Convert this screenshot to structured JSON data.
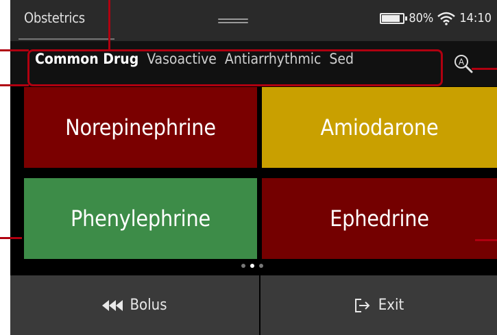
{
  "header": {
    "title": "Obstetrics",
    "battery_percent": "80%",
    "battery_level": 0.8,
    "time": "14:10"
  },
  "tabs": [
    {
      "label": "Common Drug",
      "active": true
    },
    {
      "label": "Vasoactive",
      "active": false
    },
    {
      "label": "Antiarrhythmic",
      "active": false
    },
    {
      "label": "Sed",
      "active": false
    }
  ],
  "drugs": [
    {
      "label": "Norepinephrine",
      "color": "#7a0000"
    },
    {
      "label": "Amiodarone",
      "color": "#c9a000"
    },
    {
      "label": "Phenylephrine",
      "color": "#3d8c48"
    },
    {
      "label": "Ephedrine",
      "color": "#740000"
    }
  ],
  "pager": {
    "pages": 3,
    "current": 2
  },
  "footer": {
    "bolus_label": "Bolus",
    "exit_label": "Exit"
  },
  "icons": [
    "wifi-icon",
    "battery-icon",
    "search-icon",
    "rewind-icon",
    "exit-icon"
  ],
  "colors": {
    "annotation": "#b00010"
  }
}
